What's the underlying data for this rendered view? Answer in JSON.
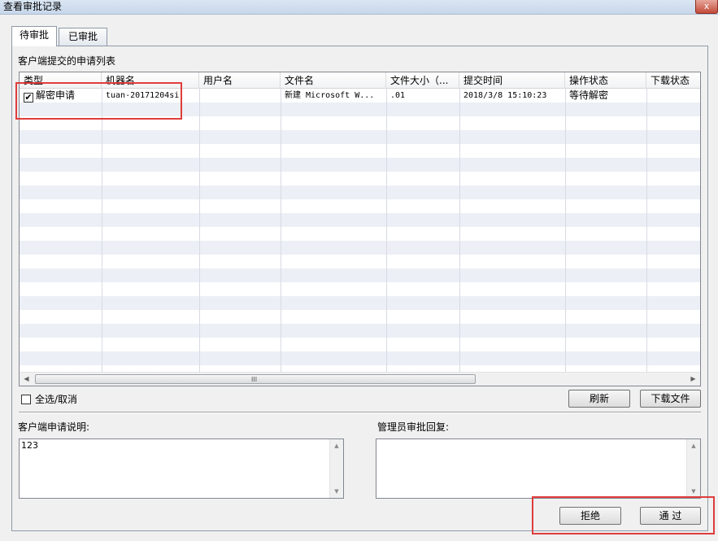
{
  "window": {
    "title": "查看审批记录",
    "close_glyph": "x"
  },
  "tabs": [
    {
      "label": "待审批",
      "active": true
    },
    {
      "label": "已审批",
      "active": false
    }
  ],
  "list": {
    "group_label": "客户端提交的申请列表",
    "columns": [
      "类型",
      "机器名",
      "用户名",
      "文件名",
      "文件大小（...",
      "提交时间",
      "操作状态",
      "下载状态"
    ],
    "rows": [
      {
        "checked": true,
        "type": "解密申请",
        "machine": "tuan-20171204si",
        "user": "",
        "file_name": "新建 Microsoft W...",
        "file_size": ".01",
        "submit_time": "2018/3/8 15:10:23",
        "op_status": "等待解密",
        "dl_status": ""
      }
    ],
    "scroll_grip": "III"
  },
  "select_all": {
    "label": "全选/取消",
    "checked": false
  },
  "buttons": {
    "refresh": "刷新",
    "download": "下载文件",
    "reject": "拒绝",
    "pass": "通 过"
  },
  "client_note": {
    "label": "客户端申请说明:",
    "value": "123"
  },
  "admin_reply": {
    "label": "管理员审批回复:",
    "value": ""
  },
  "highlight_color": "#e03c3c"
}
